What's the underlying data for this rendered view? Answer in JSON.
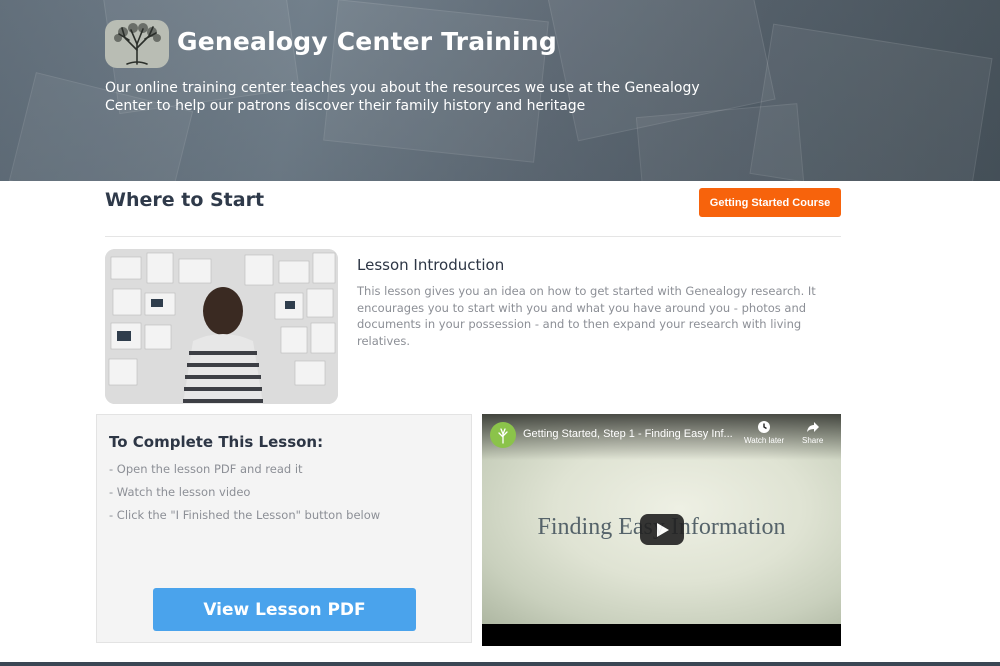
{
  "header": {
    "title": "Genealogy Center Training",
    "description": "Our online training center teaches you about the resources we use at the Genealogy Center to help our patrons discover their family history and heritage",
    "logo_icon": "tree-icon"
  },
  "section": {
    "title": "Where to Start",
    "course_button_label": "Getting Started Course",
    "accent_color": "#f7630c"
  },
  "lesson": {
    "image_icon": "person-at-board-photo",
    "title": "Lesson Introduction",
    "text": "This lesson gives you an idea on how to get started with Genealogy research. It encourages you to start with you and what you have around you - photos and documents in your possession - and to then expand your research with living relatives."
  },
  "complete": {
    "title": "To Complete This Lesson:",
    "steps": [
      "- Open the lesson PDF and read it",
      "- Watch the lesson video",
      "- Click the \"I Finished the Lesson\" button below"
    ],
    "pdf_button_label": "View Lesson PDF",
    "pdf_button_color": "#4aa3ec"
  },
  "video": {
    "title": "Getting Started, Step 1 - Finding Easy Inf...",
    "watch_later_label": "Watch later",
    "share_label": "Share",
    "caption": "Finding Easy Information",
    "play_icon": "play-icon"
  }
}
